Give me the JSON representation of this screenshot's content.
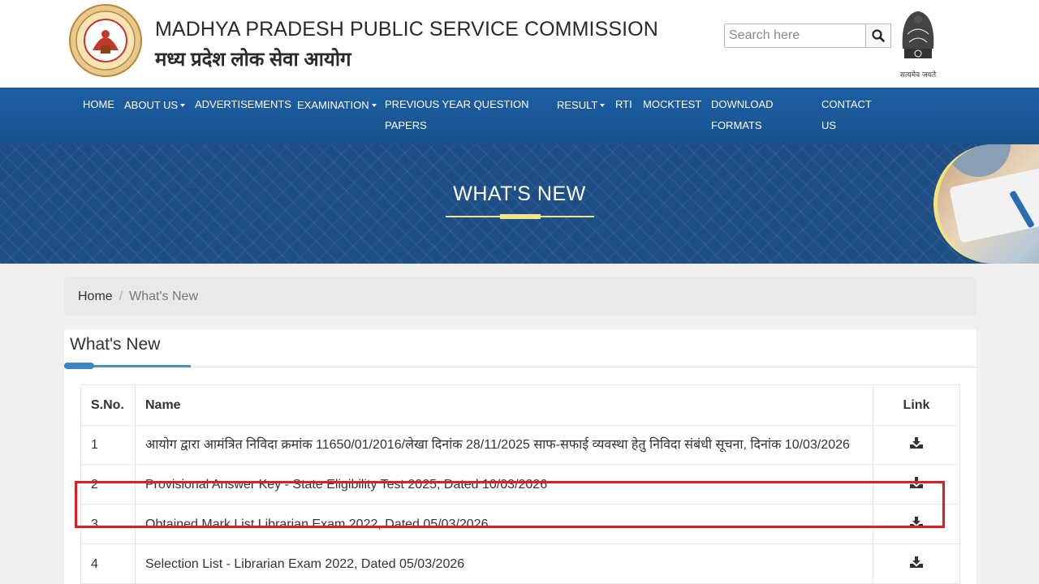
{
  "header": {
    "org_name_en": "MADHYA PRADESH PUBLIC SERVICE COMMISSION",
    "org_name_hi": "मध्य प्रदेश लोक सेवा आयोग",
    "search_placeholder": "Search here",
    "emblem_motto": "सत्यमेव जयते"
  },
  "nav": {
    "items": [
      {
        "label": "HOME"
      },
      {
        "label": "ABOUT US",
        "dropdown": true
      },
      {
        "label": "ADVERTISEMENTS"
      },
      {
        "label": "EXAMINATION",
        "dropdown": true
      },
      {
        "label": "PREVIOUS YEAR QUESTION",
        "label2": "PAPERS"
      },
      {
        "label": "RESULT",
        "dropdown": true
      },
      {
        "label": "RTI"
      },
      {
        "label": "MOCKTEST"
      },
      {
        "label": "DOWNLOAD",
        "label2": "FORMATS"
      },
      {
        "label": "CONTACT",
        "label2": "US"
      }
    ]
  },
  "banner": {
    "title": "WHAT'S NEW"
  },
  "breadcrumb": {
    "home": "Home",
    "separator": "/",
    "current": "What's New"
  },
  "panel": {
    "title": "What's New",
    "table": {
      "headers": {
        "sno": "S.No.",
        "name": "Name",
        "link": "Link"
      },
      "rows": [
        {
          "sno": "1",
          "name": "आयोग द्वारा आमंत्रित निविदा क्रमांक 11650/01/2016/लेखा दिनांक 28/11/2025 साफ-सफाई व्यवस्था हेतु निविदा संबंधी सूचना, दिनांक 10/03/2026"
        },
        {
          "sno": "2",
          "name": "Provisional Answer Key - State Eligibility Test 2025, Dated 10/03/2026"
        },
        {
          "sno": "3",
          "name": "Obtained Mark List Librarian Exam 2022, Dated 05/03/2026"
        },
        {
          "sno": "4",
          "name": "Selection List - Librarian Exam 2022, Dated 05/03/2026"
        }
      ]
    }
  },
  "colors": {
    "nav_bg": "#1b5a9c",
    "highlight": "#e31b23",
    "accent_yellow": "#f0e38a"
  }
}
